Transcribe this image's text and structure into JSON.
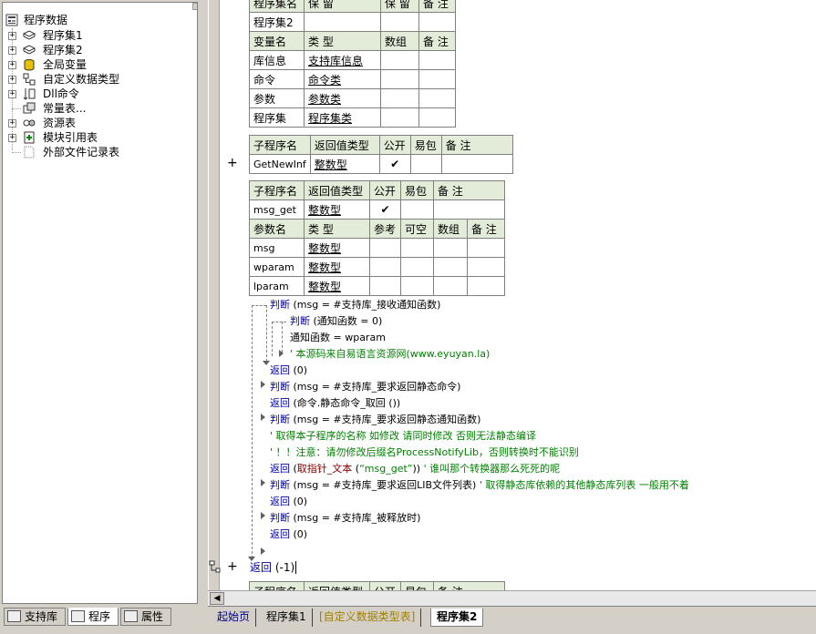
{
  "tree": {
    "root": "程序数据",
    "items": [
      {
        "label": "程序集1",
        "icon": "module-icon",
        "expander": "+"
      },
      {
        "label": "程序集2",
        "icon": "module-icon",
        "expander": "+"
      },
      {
        "label": "全局变量",
        "icon": "database-icon",
        "expander": "+"
      },
      {
        "label": "自定义数据类型",
        "icon": "datatype-icon",
        "expander": "+"
      },
      {
        "label": "Dll命令",
        "icon": "dll-icon",
        "expander": "+"
      },
      {
        "label": "常量表...",
        "icon": "constants-icon",
        "expander": ""
      },
      {
        "label": "资源表",
        "icon": "resource-icon",
        "expander": "+"
      },
      {
        "label": "模块引用表",
        "icon": "module-ref-icon",
        "expander": "+"
      },
      {
        "label": "外部文件记录表",
        "icon": "file-icon",
        "expander": ""
      }
    ]
  },
  "left_tabs": [
    {
      "label": "支持库",
      "icon": "library-icon"
    },
    {
      "label": "程序",
      "icon": "program-icon"
    },
    {
      "label": "属性",
      "icon": "property-icon"
    }
  ],
  "assembly_table": {
    "header1": [
      "程序集名",
      "保 留",
      "保 留",
      "备 注"
    ],
    "name": "程序集2",
    "header2": [
      "变量名",
      "类 型",
      "数组",
      "备 注"
    ],
    "rows": [
      {
        "name": "库信息",
        "type": "支持库信息"
      },
      {
        "name": "命令",
        "type": "命令类"
      },
      {
        "name": "参数",
        "type": "参数类"
      },
      {
        "name": "程序集",
        "type": "程序集类"
      }
    ]
  },
  "sub1": {
    "header": [
      "子程序名",
      "返回值类型",
      "公开",
      "易包",
      "备 注"
    ],
    "name": "GetNewInf",
    "return_type": "整数型",
    "public_mark": "✔"
  },
  "sub2": {
    "header": [
      "子程序名",
      "返回值类型",
      "公开",
      "易包",
      "备 注"
    ],
    "name": "msg_get",
    "return_type": "整数型",
    "public_mark": "✔",
    "param_header": [
      "参数名",
      "类 型",
      "参考",
      "可空",
      "数组",
      "备 注"
    ],
    "params": [
      {
        "name": "msg",
        "type": "整数型"
      },
      {
        "name": "wparam",
        "type": "整数型"
      },
      {
        "name": "lparam",
        "type": "整数型"
      }
    ]
  },
  "code": {
    "l1": {
      "kw": "判断",
      "text": " (msg = #支持库_接收通知函数)"
    },
    "l2": {
      "kw": "判断",
      "text": " (通知函数 = 0)"
    },
    "l3": {
      "text": "通知函数 = wparam"
    },
    "l4": {
      "cm": "' 本源码来自易语言资源网(www.eyuyan.la)"
    },
    "l5": {
      "kw": "返回",
      "text": " (0)"
    },
    "l6": {
      "kw": "判断",
      "text": " (msg = #支持库_要求返回静态命令)"
    },
    "l7": {
      "kw": "返回",
      "text": " (命令.静态命令_取回 ())"
    },
    "l8": {
      "kw": "判断",
      "text": " (msg = #支持库_要求返回静态通知函数)"
    },
    "l9": {
      "cm": "' 取得本子程序的名称 如修改 请同时修改 否则无法静态编译"
    },
    "l10": {
      "cm": "' ！！注意：请勿修改后缀名ProcessNotifyLib，否则转换时不能识别"
    },
    "l11": {
      "kw": "返回",
      "text1": " (",
      "fn": "取指针_文本",
      "text2": " (",
      "str": "“msg_get”",
      "text3": ")) ",
      "cm": "' 谁叫那个转换器那么死死的呢"
    },
    "l12": {
      "kw": "判断",
      "text": " (msg = #支持库_要求返回LIB文件列表) ",
      "cm": "' 取得静态库依赖的其他静态库列表 一般用不着"
    },
    "l13": {
      "kw": "返回",
      "text": " (0)"
    },
    "l14": {
      "kw": "判断",
      "text": " (msg = #支持库_被释放时)"
    },
    "l15": {
      "kw": "返回",
      "text": " (0)"
    },
    "l16": {
      "kw": "返回",
      "text": " (-1)"
    }
  },
  "sub3_header": [
    "子程序名",
    "返回值类型",
    "公开",
    "易包",
    "备 注"
  ],
  "bottom_tabs": [
    "起始页",
    "程序集1",
    "[自定义数据类型表]",
    "程序集2"
  ],
  "colors": {
    "header_bg": "#e3ebd9",
    "keyword": "#0000a0",
    "comment": "#008000",
    "type_link": "#0000c0"
  }
}
